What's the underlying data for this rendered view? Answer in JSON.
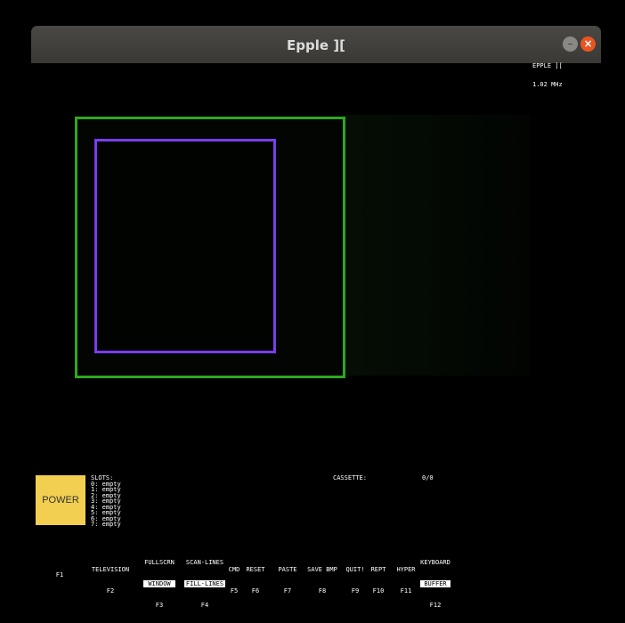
{
  "window": {
    "title": "Epple ][",
    "minimize_glyph": "–",
    "close_glyph": "×"
  },
  "status": {
    "model": "EPPLE ][",
    "speed": "1.02 MHz"
  },
  "power_label": "POWER",
  "slots": {
    "header": "SLOTS:",
    "items": [
      "0: empty",
      "1: empty",
      "2: empty",
      "3: empty",
      "4: empty",
      "5: empty",
      "6: empty",
      "7: empty"
    ]
  },
  "cassette": {
    "label": "CASSETTE:",
    "count": "0/0"
  },
  "fkeys": [
    {
      "top": "",
      "inv": "",
      "label": "",
      "key": "F1"
    },
    {
      "top": "",
      "inv": "",
      "label": "TELEVISION",
      "key": "F2"
    },
    {
      "top": "FULLSCRN",
      "inv": "WINDOW",
      "label": "",
      "key": "F3"
    },
    {
      "top": "SCAN-LINES",
      "inv": "FILL-LINES",
      "label": "",
      "key": "F4"
    },
    {
      "top": "",
      "inv": "",
      "label": "CMD",
      "key": "F5"
    },
    {
      "top": "",
      "inv": "",
      "label": "RESET",
      "key": "F6"
    },
    {
      "top": "",
      "inv": "",
      "label": "PASTE",
      "key": "F7"
    },
    {
      "top": "",
      "inv": "",
      "label": "SAVE BMP",
      "key": "F8"
    },
    {
      "top": "",
      "inv": "",
      "label": "QUIT!",
      "key": "F9"
    },
    {
      "top": "",
      "inv": "",
      "label": "REPT",
      "key": "F10"
    },
    {
      "top": "",
      "inv": "",
      "label": "HYPER",
      "key": "F11"
    },
    {
      "top": "KEYBOARD",
      "inv": "BUFFER",
      "label": "",
      "key": "F12"
    }
  ],
  "colors": {
    "power_button": "#f2cf50",
    "outer_frame": "#2ea81e",
    "inner_frame": "#7a3cf0",
    "close_button": "#e95420"
  }
}
